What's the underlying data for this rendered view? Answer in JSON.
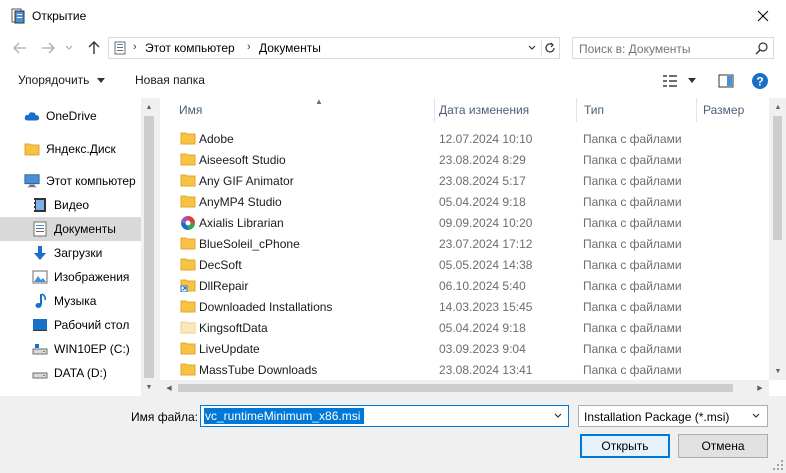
{
  "window": {
    "title": "Открытие"
  },
  "navigation": {
    "breadcrumbs": [
      "Этот компьютер",
      "Документы"
    ],
    "search_placeholder": "Поиск в: Документы"
  },
  "toolbar": {
    "organize_label": "Упорядочить",
    "new_folder_label": "Новая папка"
  },
  "sidebar": {
    "items": [
      {
        "label": "OneDrive",
        "icon": "onedrive-icon"
      },
      {
        "label": "Яндекс.Диск",
        "icon": "folder-icon"
      },
      {
        "label": "Этот компьютер",
        "icon": "computer-icon"
      },
      {
        "label": "Видео",
        "icon": "video-icon"
      },
      {
        "label": "Документы",
        "icon": "documents-icon",
        "selected": true
      },
      {
        "label": "Загрузки",
        "icon": "downloads-icon"
      },
      {
        "label": "Изображения",
        "icon": "images-icon"
      },
      {
        "label": "Музыка",
        "icon": "music-icon"
      },
      {
        "label": "Рабочий стол",
        "icon": "desktop-icon"
      },
      {
        "label": "WIN10EP (C:)",
        "icon": "drive-icon"
      },
      {
        "label": "DATA (D:)",
        "icon": "drive-icon"
      }
    ]
  },
  "file_list": {
    "columns": [
      "Имя",
      "Дата изменения",
      "Тип",
      "Размер"
    ],
    "rows": [
      {
        "name": "Adobe",
        "date": "12.07.2024 10:10",
        "type": "Папка с файлами",
        "icon": "folder-icon"
      },
      {
        "name": "Aiseesoft Studio",
        "date": "23.08.2024 8:29",
        "type": "Папка с файлами",
        "icon": "folder-icon"
      },
      {
        "name": "Any GIF Animator",
        "date": "23.08.2024 5:17",
        "type": "Папка с файлами",
        "icon": "folder-icon"
      },
      {
        "name": "AnyMP4 Studio",
        "date": "05.04.2024 9:18",
        "type": "Папка с файлами",
        "icon": "folder-icon"
      },
      {
        "name": "Axialis Librarian",
        "date": "09.09.2024 10:20",
        "type": "Папка с файлами",
        "icon": "axialis-icon"
      },
      {
        "name": "BlueSoleil_cPhone",
        "date": "23.07.2024 17:12",
        "type": "Папка с файлами",
        "icon": "folder-icon"
      },
      {
        "name": "DecSoft",
        "date": "05.05.2024 14:38",
        "type": "Папка с файлами",
        "icon": "folder-icon"
      },
      {
        "name": "DllRepair",
        "date": "06.10.2024 5:40",
        "type": "Папка с файлами",
        "icon": "folder-shortcut-icon"
      },
      {
        "name": "Downloaded Installations",
        "date": "14.03.2023 15:45",
        "type": "Папка с файлами",
        "icon": "folder-icon"
      },
      {
        "name": "KingsoftData",
        "date": "05.04.2024 9:18",
        "type": "Папка с файлами",
        "icon": "folder-light-icon"
      },
      {
        "name": "LiveUpdate",
        "date": "03.09.2023 9:04",
        "type": "Папка с файлами",
        "icon": "folder-icon"
      },
      {
        "name": "MassTube Downloads",
        "date": "23.08.2024 13:41",
        "type": "Папка с файлами",
        "icon": "folder-icon"
      }
    ]
  },
  "footer": {
    "filename_label": "Имя файла:",
    "filename_value": "vc_runtimeMinimum_x86.msi",
    "filetype_selected": "Installation Package (*.msi)",
    "open_label": "Открыть",
    "cancel_label": "Отмена"
  },
  "colors": {
    "accent": "#0078d7",
    "folder": "#f8c243",
    "folder_dark": "#e1a62c"
  }
}
